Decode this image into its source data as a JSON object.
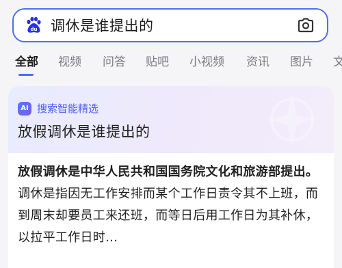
{
  "search": {
    "query": "调休是谁提出的",
    "logo_icon": "baidu-paw-icon",
    "camera_icon": "camera-icon"
  },
  "tabs": [
    {
      "label": "全部",
      "active": true
    },
    {
      "label": "视频",
      "active": false
    },
    {
      "label": "问答",
      "active": false
    },
    {
      "label": "贴吧",
      "active": false
    },
    {
      "label": "小视频",
      "active": false
    },
    {
      "label": "资讯",
      "active": false
    },
    {
      "label": "图片",
      "active": false
    },
    {
      "label": "文",
      "active": false
    }
  ],
  "ai_card": {
    "badge": "AI",
    "label": "搜索智能精选",
    "question": "放假调休是谁提出的",
    "answer_bold": "放假调休是中华人民共和国国务院文化和旅游部提出。",
    "answer_rest": "调休是指因无工作安排而某个工作日责令其不上班，而到周末却要员工来还班，而等日后用工作日为其补休，以拉平工作日时..."
  },
  "colors": {
    "accent": "#4e6ef2",
    "ai_label": "#4e5cf0",
    "background": "#f5f5f7"
  }
}
